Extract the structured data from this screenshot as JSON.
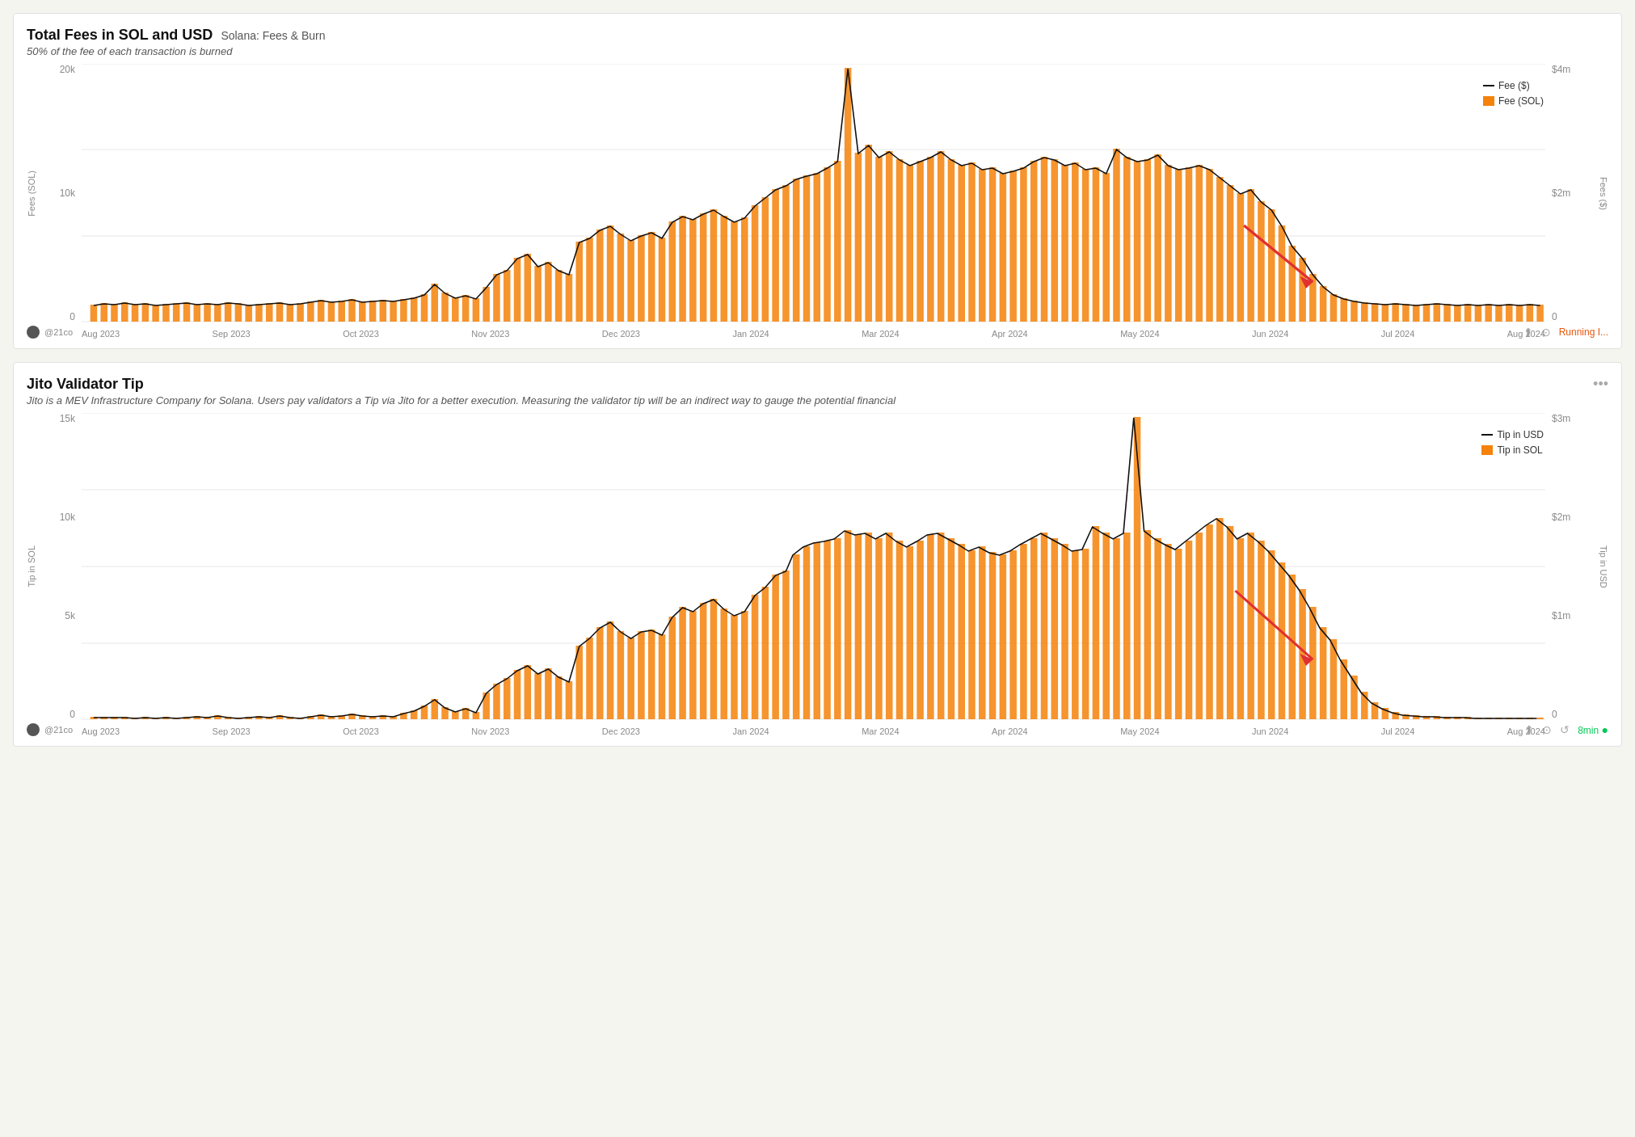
{
  "chart1": {
    "title": "Total Fees in SOL and USD",
    "subtitle_inline": "Solana: Fees & Burn",
    "subtitle": "50% of the fee of each transaction is burned",
    "y_left_label": "Fees (SOL)",
    "y_right_label": "Fees ($)",
    "y_left_ticks": [
      "20k",
      "10k",
      "0"
    ],
    "y_right_ticks": [
      "$4m",
      "$2m",
      "0"
    ],
    "x_ticks": [
      "Aug 2023",
      "Sep 2023",
      "Oct 2023",
      "Nov 2023",
      "Dec 2023",
      "Jan 2024",
      "Mar 2024",
      "Apr 2024",
      "May 2024",
      "Jun 2024",
      "Jul 2024",
      "Aug 2024"
    ],
    "author": "@21co",
    "status": "Running I...",
    "legend": [
      {
        "label": "Fee ($)",
        "color": "#111",
        "type": "line"
      },
      {
        "label": "Fee (SOL)",
        "color": "#f5820a",
        "type": "bar"
      }
    ]
  },
  "chart2": {
    "title": "Jito Validator Tip",
    "subtitle": "Jito is a MEV Infrastructure Company for Solana. Users pay validators a Tip via Jito for a better execution. Measuring the validator tip will be an indirect way to gauge the potential financial",
    "y_left_label": "Tip in SOL",
    "y_right_label": "Tip in USD",
    "y_left_ticks": [
      "15k",
      "10k",
      "5k",
      "0"
    ],
    "y_right_ticks": [
      "$3m",
      "$2m",
      "$1m",
      "0"
    ],
    "x_ticks": [
      "Aug 2023",
      "Sep 2023",
      "Oct 2023",
      "Nov 2023",
      "Dec 2023",
      "Jan 2024",
      "Mar 2024",
      "Apr 2024",
      "May 2024",
      "Jun 2024",
      "Jul 2024",
      "Aug 2024"
    ],
    "author": "@21co",
    "status": "8min",
    "legend": [
      {
        "label": "Tip in USD",
        "color": "#111",
        "type": "line"
      },
      {
        "label": "Tip in SOL",
        "color": "#f5820a",
        "type": "bar"
      }
    ]
  },
  "icons": {
    "avatar": "●",
    "dots": "•••",
    "share": "⬆",
    "camera": "📷",
    "refresh": "↺",
    "green_dot": "●"
  }
}
